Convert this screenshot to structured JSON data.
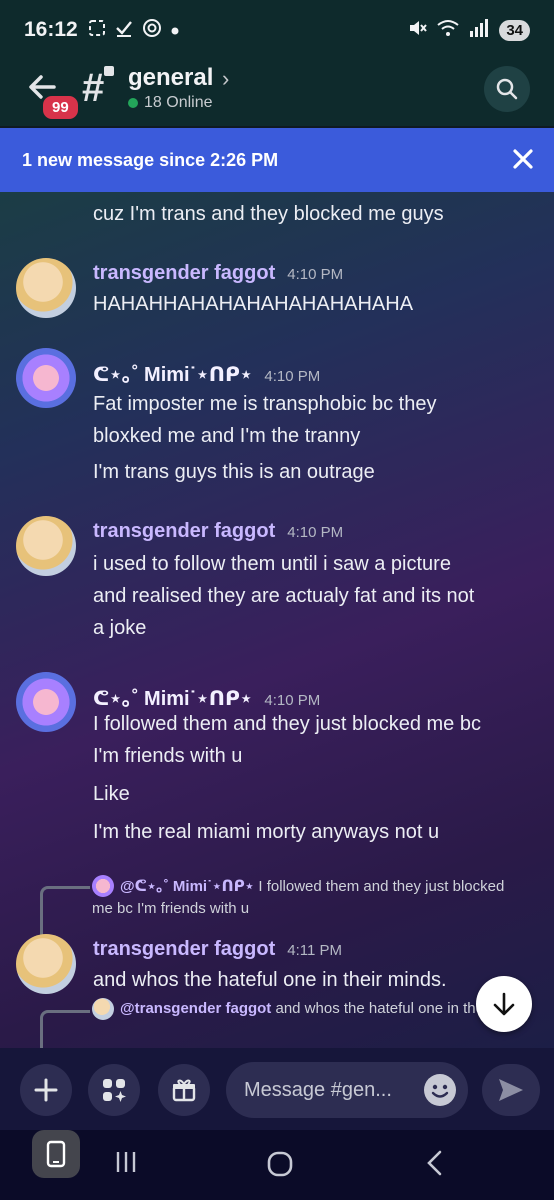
{
  "status_bar": {
    "time": "16:12",
    "left_icons": [
      "screenshot-icon",
      "check-icon",
      "at-icon",
      "dot-icon"
    ],
    "right_icons": [
      "mute-icon",
      "wifi-icon",
      "signal-icon"
    ],
    "battery": "34"
  },
  "header": {
    "unread_count": "99",
    "channel_name": "general",
    "online_text": "18 Online",
    "online_color": "#23a55a"
  },
  "banner": {
    "text": "1 new message since 2:26 PM",
    "color": "#3b5bdb"
  },
  "messages": {
    "partial": {
      "line": "cuz I'm trans and they blocked me guys"
    },
    "m1": {
      "author": "transgender faggot",
      "time": "4:10 PM",
      "lines": [
        "HAHAHHAHAHAHAHAHAHAHAHA"
      ]
    },
    "m2": {
      "author": "ᕦ⋆｡˚ Mimi˙⋆ᑎᑭ⋆",
      "time": "4:10 PM",
      "lines": [
        "Fat imposter me is transphobic bc they",
        "bloxked me and I'm the tranny",
        "I'm trans guys this is an outrage"
      ]
    },
    "m3": {
      "author": "transgender faggot",
      "time": "4:10 PM",
      "lines": [
        "i used to follow them until i saw a picture",
        "and realised they are actualy fat and its not",
        "a joke"
      ]
    },
    "m4": {
      "author": "ᕦ⋆｡˚ Mimi˙⋆ᑎᑭ⋆",
      "time": "4:10 PM",
      "lines": [
        "I followed them and they just blocked me bc",
        "I'm friends with u",
        "Like",
        "I'm the real miami morty anyways not u"
      ]
    },
    "reply1": {
      "mention": "@ᕦ⋆｡˚ Mimi˙⋆ᑎᑭ⋆",
      "text_line1": "I followed them and they just blocked",
      "text_line2": "me bc I'm friends with u"
    },
    "m5": {
      "author": "transgender faggot",
      "time": "4:11 PM",
      "lines": [
        "and whos the hateful one in their minds."
      ]
    },
    "reply2": {
      "mention": "@transgender faggot",
      "text": "and whos the hateful one in their"
    }
  },
  "composer": {
    "placeholder": "Message #gen..."
  }
}
